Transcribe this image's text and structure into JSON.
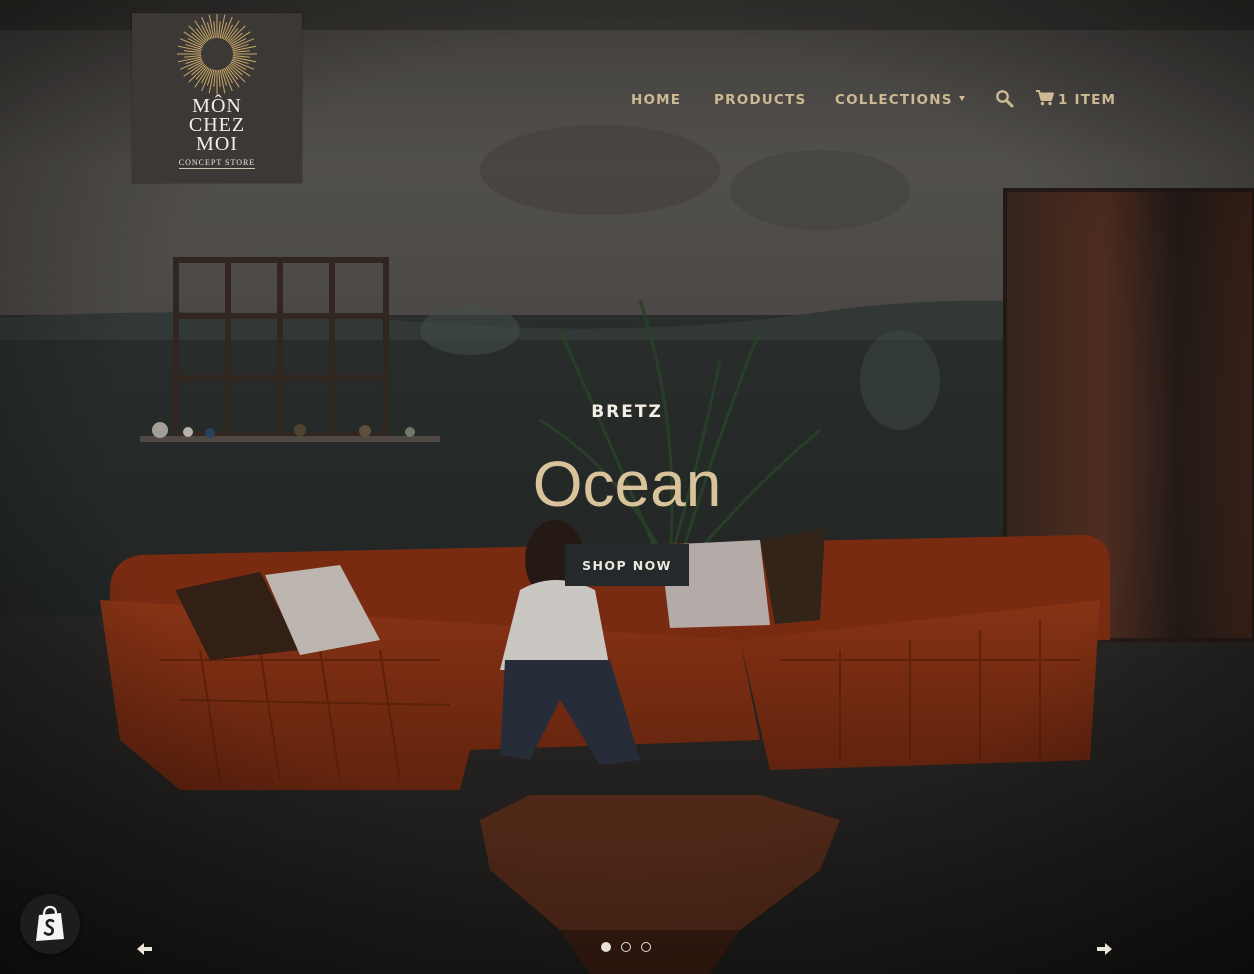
{
  "logo": {
    "line1": "MÔN",
    "line2": "CHEZ",
    "line3": "MOI",
    "tagline": "CONCEPT STORE"
  },
  "nav": {
    "items": [
      {
        "label": "HOME"
      },
      {
        "label": "PRODUCTS"
      },
      {
        "label": "COLLECTIONS"
      }
    ],
    "cart_label": "1 ITEM"
  },
  "slide": {
    "subtitle": "BRETZ",
    "title": "Ocean",
    "button_label": "SHOP NOW",
    "current": 1,
    "total": 3
  },
  "icons": {
    "logo": "sunburst-icon",
    "search": "search-icon",
    "cart": "cart-icon",
    "dropdown": "caret-down-icon",
    "prev": "arrow-left-icon",
    "next": "arrow-right-icon",
    "badge": "shopify-bag-icon"
  },
  "colors": {
    "nav_text": "#cdb993",
    "title": "#d9c39a",
    "button_bg": "#24292c",
    "logo_bg": "#3b3835",
    "sofa": "#8a3215"
  }
}
